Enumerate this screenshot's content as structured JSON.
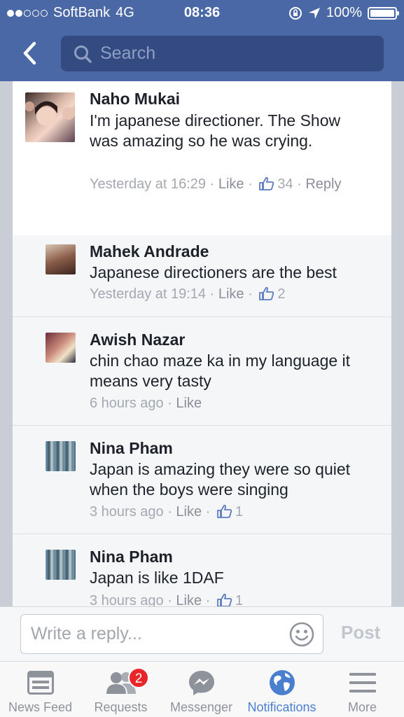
{
  "status_bar": {
    "carrier": "SoftBank",
    "network": "4G",
    "time": "08:36",
    "battery": "100%"
  },
  "nav": {
    "back_icon": "chevron-left-icon",
    "search_placeholder": "Search"
  },
  "comments": [
    {
      "name": "Naho Mukai",
      "text": "I'm japanese directioner. The Show was amazing so he was crying.",
      "time": "Yesterday at 16:29",
      "like": "Like",
      "likes": "34",
      "reply": "Reply"
    },
    {
      "name": "Mahek Andrade",
      "text": "Japanese directioners are the best",
      "time": "Yesterday at 19:14",
      "like": "Like",
      "likes": "2"
    },
    {
      "name": "Awish Nazar",
      "text": "chin chao maze ka in my language it means very tasty",
      "time": "6 hours ago",
      "like": "Like"
    },
    {
      "name": "Nina Pham",
      "text": "Japan is amazing they were so quiet when the boys were singing",
      "time": "3 hours ago",
      "like": "Like",
      "likes": "1"
    },
    {
      "name": "Nina Pham",
      "text": "Japan is like 1DAF",
      "time": "3 hours ago",
      "like": "Like",
      "likes": "1"
    }
  ],
  "reply_bar": {
    "placeholder": "Write a reply...",
    "post_label": "Post"
  },
  "tabs": [
    {
      "label": "News Feed",
      "icon": "news-feed-icon"
    },
    {
      "label": "Requests",
      "icon": "friend-requests-icon",
      "badge": "2"
    },
    {
      "label": "Messenger",
      "icon": "messenger-icon"
    },
    {
      "label": "Notifications",
      "icon": "globe-icon",
      "active": true
    },
    {
      "label": "More",
      "icon": "menu-icon"
    }
  ],
  "colors": {
    "header_blue": "#4a67a6",
    "search_bg": "#344b82",
    "active_tab": "#4a7fd0",
    "badge_red": "#e8262a"
  }
}
